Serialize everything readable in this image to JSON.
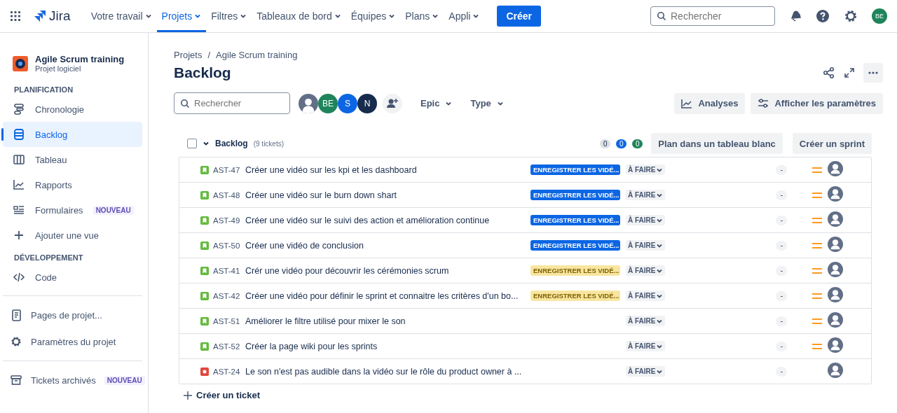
{
  "top_nav": {
    "logo": "Jira",
    "items": [
      {
        "label": "Votre travail",
        "selected": false
      },
      {
        "label": "Projets",
        "selected": true
      },
      {
        "label": "Filtres",
        "selected": false
      },
      {
        "label": "Tableaux de bord",
        "selected": false
      },
      {
        "label": "Équipes",
        "selected": false
      },
      {
        "label": "Plans",
        "selected": false
      },
      {
        "label": "Appli",
        "selected": false
      }
    ],
    "create": "Créer",
    "search": {
      "placeholder": "Rechercher"
    },
    "avatar": "BE"
  },
  "sidebar": {
    "project": {
      "name": "Agile Scrum training",
      "type": "Projet logiciel"
    },
    "sections": [
      {
        "heading": "PLANIFICATION",
        "items": [
          {
            "label": "Chronologie",
            "selected": false
          },
          {
            "label": "Backlog",
            "selected": true
          },
          {
            "label": "Tableau",
            "selected": false
          },
          {
            "label": "Rapports",
            "selected": false
          },
          {
            "label": "Formulaires",
            "selected": false,
            "badge": "NOUVEAU"
          },
          {
            "label": "Ajouter une vue",
            "selected": false
          }
        ]
      },
      {
        "heading": "DÉVELOPPEMENT",
        "items": [
          {
            "label": "Code",
            "selected": false
          }
        ]
      }
    ],
    "links": [
      {
        "label": "Pages de projet..."
      },
      {
        "label": "Paramètres du projet"
      },
      {
        "label": "Tickets archivés",
        "badge": "NOUVEAU"
      }
    ]
  },
  "breadcrumbs": {
    "items": [
      "Projets",
      "Agile Scrum training"
    ],
    "separator": "/"
  },
  "title": "Backlog",
  "filters": {
    "search": {
      "placeholder": "Rechercher"
    },
    "avatars": [
      {
        "color": "#626f86"
      },
      {
        "initials": "BE",
        "color": "#1f845a"
      },
      {
        "initials": "S",
        "color": "#0c66e4"
      },
      {
        "initials": "N",
        "color": "#172b4d"
      }
    ],
    "dropdowns": [
      "Epic",
      "Type"
    ],
    "buttons": [
      "Analyses",
      "Afficher les paramètres"
    ]
  },
  "backlog": {
    "checked": false,
    "name": "Backlog",
    "count": "(9 tickets)",
    "counters": [
      {
        "value": "0",
        "color": "#dcdfe4"
      },
      {
        "value": "0",
        "color": "#0c66e4"
      },
      {
        "value": "0",
        "color": "#1f845a"
      }
    ],
    "buttons": [
      "Plan dans un tableau blanc",
      "Créer un sprint"
    ],
    "rows": [
      {
        "kind": "story",
        "key": "AST-47",
        "summary": "Créer une vidéo sur les kpi et les dashboard",
        "epic": {
          "label": "ENREGISTRER LES VIDÉ...",
          "color": "#0c66e4"
        },
        "status": "À FAIRE",
        "estimate": "-",
        "medium_priority": true
      },
      {
        "kind": "story",
        "key": "AST-48",
        "summary": "Créer une vidéo sur le burn down shart",
        "epic": {
          "label": "ENREGISTRER LES VIDÉ...",
          "color": "#0c66e4"
        },
        "status": "À FAIRE",
        "estimate": "-",
        "medium_priority": true
      },
      {
        "kind": "story",
        "key": "AST-49",
        "summary": "Créer une vidéo sur le suivi des action et amélioration continue",
        "epic": {
          "label": "ENREGISTRER LES VIDÉ...",
          "color": "#0c66e4"
        },
        "status": "À FAIRE",
        "estimate": "-",
        "medium_priority": true
      },
      {
        "kind": "story",
        "key": "AST-50",
        "summary": "Créer une vidéo de conclusion",
        "epic": {
          "label": "ENREGISTRER LES VIDÉ...",
          "color": "#0c66e4"
        },
        "status": "À FAIRE",
        "estimate": "-",
        "medium_priority": true
      },
      {
        "kind": "story",
        "key": "AST-41",
        "summary": "Crér une vidéo pour découvrir les cérémonies scrum",
        "epic": {
          "label": "ENREGISTRER LES VIDÉ...",
          "color": "#f8e6a0"
        },
        "status": "À FAIRE",
        "estimate": "-",
        "medium_priority": true
      },
      {
        "kind": "story",
        "key": "AST-42",
        "summary": "Créer une vidéo pour définir le sprint et connaitre les critères d'un bo...",
        "epic": {
          "label": "ENREGISTRER LES VIDÉ...",
          "color": "#f8e6a0"
        },
        "status": "À FAIRE",
        "estimate": "-",
        "medium_priority": true
      },
      {
        "kind": "story",
        "key": "AST-51",
        "summary": "Améliorer le filtre utilisé pour mixer le son",
        "status": "À FAIRE",
        "estimate": "-",
        "medium_priority": true
      },
      {
        "kind": "story",
        "key": "AST-52",
        "summary": "Créer la page wiki pour les sprints",
        "status": "À FAIRE",
        "estimate": "-",
        "medium_priority": true
      },
      {
        "kind": "bug",
        "key": "AST-24",
        "summary": "Le son n'est pas audible dans la vidéo sur le rôle du product owner à ...",
        "status": "À FAIRE",
        "estimate": "-",
        "medium_priority": false
      }
    ],
    "create": "Créer un ticket"
  }
}
